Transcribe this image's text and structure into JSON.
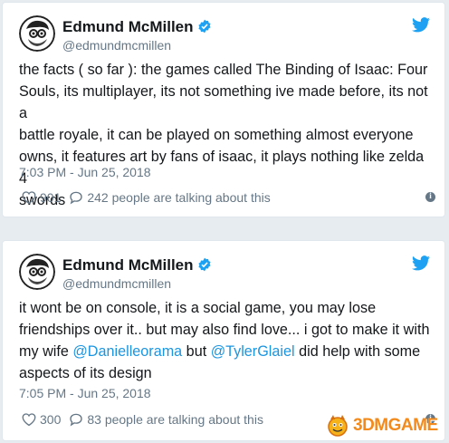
{
  "tweets": [
    {
      "author": {
        "name": "Edmund McMillen",
        "handle": "@edmundmcmillen"
      },
      "text_lines": [
        "the facts ( so far ): the games called The Binding of Isaac: Four",
        "Souls, its multiplayer, its not something ive made before, its not a",
        "battle royale, it can be played on something almost everyone",
        "owns, it features art by fans of isaac, it plays nothing like zelda 4",
        "swords"
      ],
      "timestamp": "7:03 PM - Jun 25, 2018",
      "likes": "901",
      "conversation": "242 people are talking about this"
    },
    {
      "author": {
        "name": "Edmund McMillen",
        "handle": "@edmundmcmillen"
      },
      "text": {
        "line1": "it wont be on console, it is a social game, you may lose",
        "line2": "friendships over it.. but may also find love... i got to make it with",
        "line3_pre": "my wife ",
        "mention1": "@Danielleorama",
        "line3_mid": " but ",
        "mention2": "@TylerGlaiel",
        "line3_post": " did help with some",
        "line4": "aspects of its design"
      },
      "timestamp": "7:05 PM - Jun 25, 2018",
      "likes": "300",
      "conversation": "83 people are talking about this"
    }
  ],
  "icons": {
    "verified": "verified-badge-icon",
    "bird": "twitter-bird-icon",
    "like": "heart-icon",
    "reply": "speech-bubble-icon",
    "info": "info-icon"
  },
  "colors": {
    "link": "#1b95e0",
    "muted": "#657786",
    "background": "#e6ecf0",
    "watermark": "#f28a1c"
  },
  "watermark": {
    "text": "3DMGAME"
  }
}
